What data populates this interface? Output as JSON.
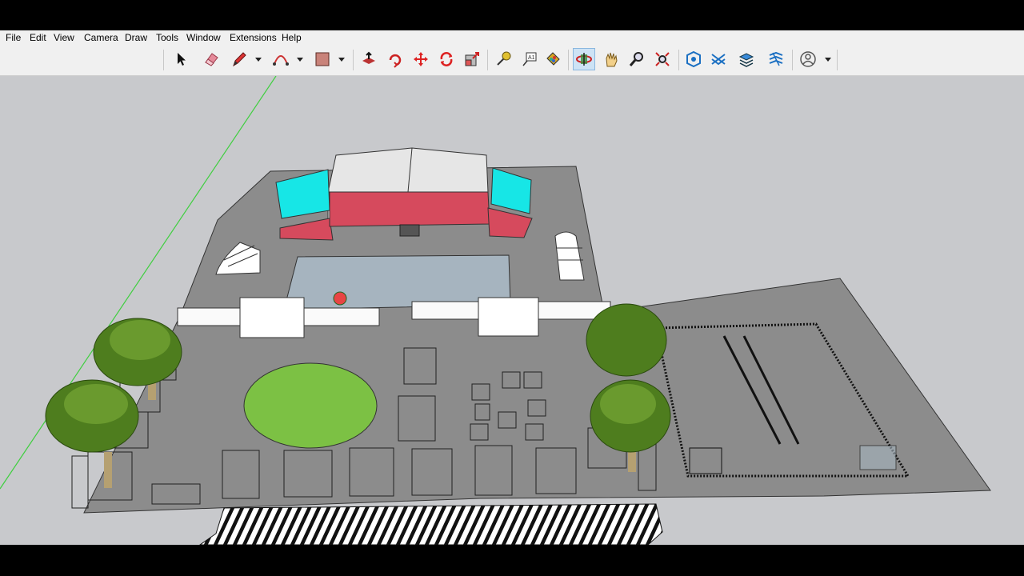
{
  "menu": {
    "file": "File",
    "edit": "Edit",
    "view": "View",
    "camera": "Camera",
    "draw": "Draw",
    "tools": "Tools",
    "window": "Window",
    "extensions": "Extensions",
    "help": "Help"
  },
  "toolbar": {
    "tools": [
      "select-icon",
      "eraser-icon",
      "pencil-icon",
      "arc-icon",
      "rectangle-icon",
      "push-pull-icon",
      "rotate-icon",
      "move-icon",
      "follow-me-icon",
      "scale-icon",
      "tape-measure-icon",
      "text-icon",
      "paint-bucket-icon",
      "orbit-icon",
      "pan-icon",
      "zoom-icon",
      "zoom-extents-icon",
      "warehouse-icon",
      "extension-warehouse-icon",
      "layout-icon",
      "sandbox-icon",
      "account-icon"
    ],
    "active_tool": "orbit-icon"
  },
  "colors": {
    "ground": "#8c8c8c",
    "stage": "#d64a5d",
    "screens": "#17e6e6",
    "roof": "#e6e6e6",
    "pool": "#a6b4bf",
    "lawn": "#7cc144",
    "trees": "#4e7d1e",
    "sky": "#c8c9cc",
    "green_axis": "#3fcf3f",
    "active_highlight": "#cde3f5"
  }
}
